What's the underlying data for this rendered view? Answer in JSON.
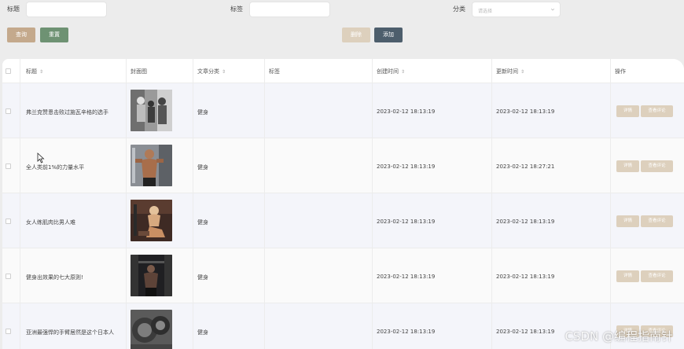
{
  "filters": {
    "title_label": "标题",
    "tag_label": "标签",
    "category_label": "分类",
    "category_placeholder": "请选择"
  },
  "buttons": {
    "query": "查询",
    "reset": "重置",
    "delete": "删除",
    "add": "添加"
  },
  "table": {
    "headers": [
      "标题",
      "封面图",
      "文章分类",
      "标签",
      "创建时间",
      "更新时间",
      "操作"
    ],
    "rows": [
      {
        "title": "弗兰克赞恩击败过施瓦辛格的选手",
        "category": "健身",
        "tag": "",
        "created": "2023-02-12 18:13:19",
        "updated": "2023-02-12 18:13:19"
      },
      {
        "title": "全人类前1%的力量水平",
        "category": "健身",
        "tag": "",
        "created": "2023-02-12 18:13:19",
        "updated": "2023-02-12 18:27:21"
      },
      {
        "title": "女人练肌肉比男人难",
        "category": "健身",
        "tag": "",
        "created": "2023-02-12 18:13:19",
        "updated": "2023-02-12 18:13:19"
      },
      {
        "title": "健身出效果的七大原则!",
        "category": "健身",
        "tag": "",
        "created": "2023-02-12 18:13:19",
        "updated": "2023-02-12 18:13:19"
      },
      {
        "title": "亚洲最强悍的手臂居然是这个日本人",
        "category": "健身",
        "tag": "",
        "created": "2023-02-12 18:13:19",
        "updated": "2023-02-12 18:13:19"
      }
    ],
    "actions": {
      "detail": "详情",
      "view_comments": "查看评论"
    }
  },
  "watermark": "CSDN @编程指南针",
  "colors": {
    "query": "#c4a98c",
    "reset": "#6e9273",
    "delete": "#ddd0bd",
    "add": "#4d5e6c",
    "row_action": "#ddd0bd"
  }
}
